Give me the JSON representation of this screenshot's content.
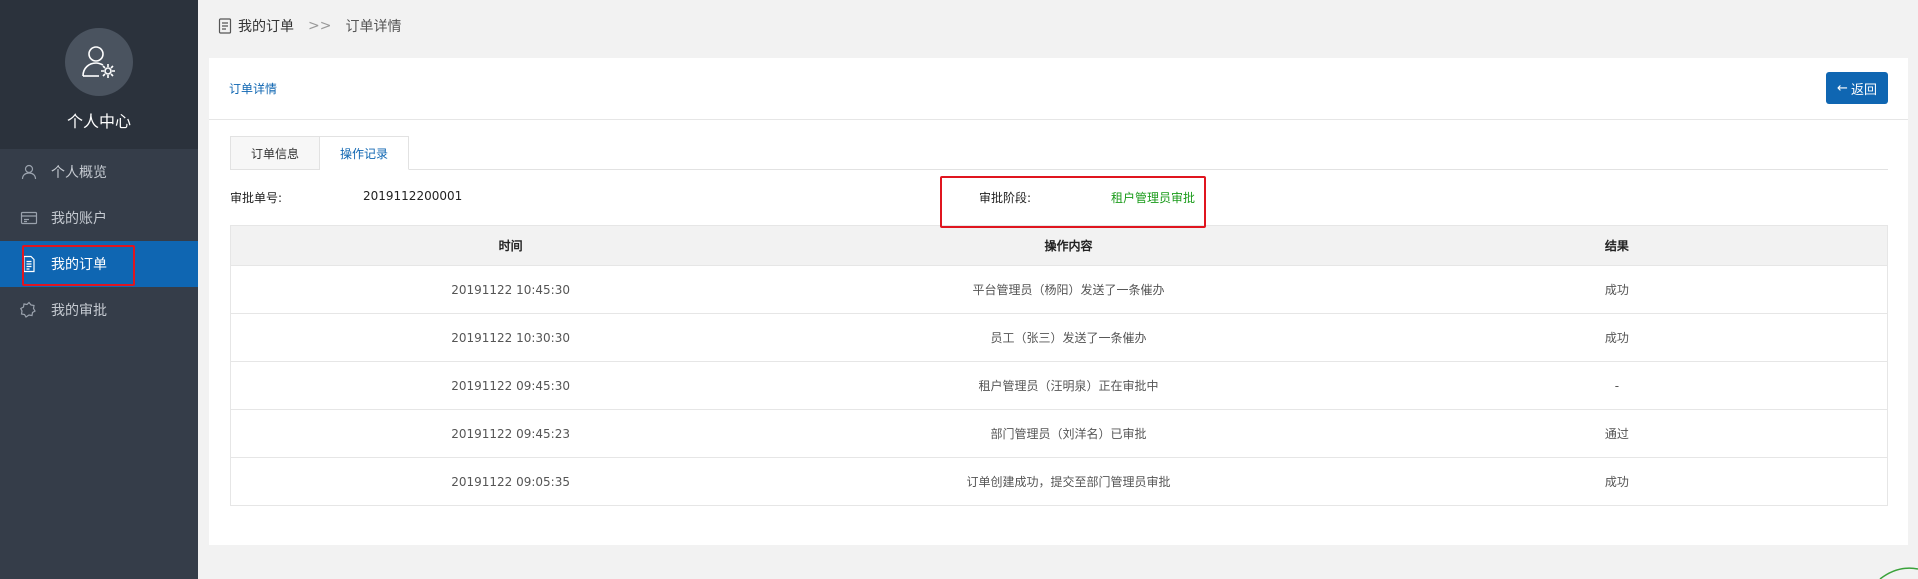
{
  "sidebar": {
    "title": "个人中心",
    "items": [
      {
        "label": "个人概览",
        "icon": "user-icon"
      },
      {
        "label": "我的账户",
        "icon": "account-card-icon"
      },
      {
        "label": "我的订单",
        "icon": "document-icon",
        "active": true
      },
      {
        "label": "我的审批",
        "icon": "approval-icon"
      }
    ]
  },
  "breadcrumb": {
    "root": "我的订单",
    "separator": ">>",
    "current": "订单详情"
  },
  "panel": {
    "title": "订单详情",
    "back_label": "返回"
  },
  "tabs": [
    {
      "label": "订单信息",
      "active": false
    },
    {
      "label": "操作记录",
      "active": true
    }
  ],
  "meta": {
    "approval_no_label": "审批单号:",
    "approval_no": "2019112200001",
    "stage_label": "审批阶段:",
    "stage_value": "租户管理员审批"
  },
  "table": {
    "headers": [
      "时间",
      "操作内容",
      "结果"
    ],
    "rows": [
      [
        "20191122 10:45:30",
        "平台管理员（杨阳）发送了一条催办",
        "成功"
      ],
      [
        "20191122 10:30:30",
        "员工（张三）发送了一条催办",
        "成功"
      ],
      [
        "20191122 09:45:30",
        "租户管理员（汪明泉）正在审批中",
        "-"
      ],
      [
        "20191122 09:45:23",
        "部门管理员（刘洋名）已审批",
        "通过"
      ],
      [
        "20191122 09:05:35",
        "订单创建成功，提交至部门管理员审批",
        "成功"
      ]
    ]
  },
  "colors": {
    "primary": "#0f66b2",
    "sidebar_bg": "#353d49",
    "sidebar_head_bg": "#2b323c",
    "highlight": "#e0151f",
    "stage_green": "#1a9b1a"
  }
}
